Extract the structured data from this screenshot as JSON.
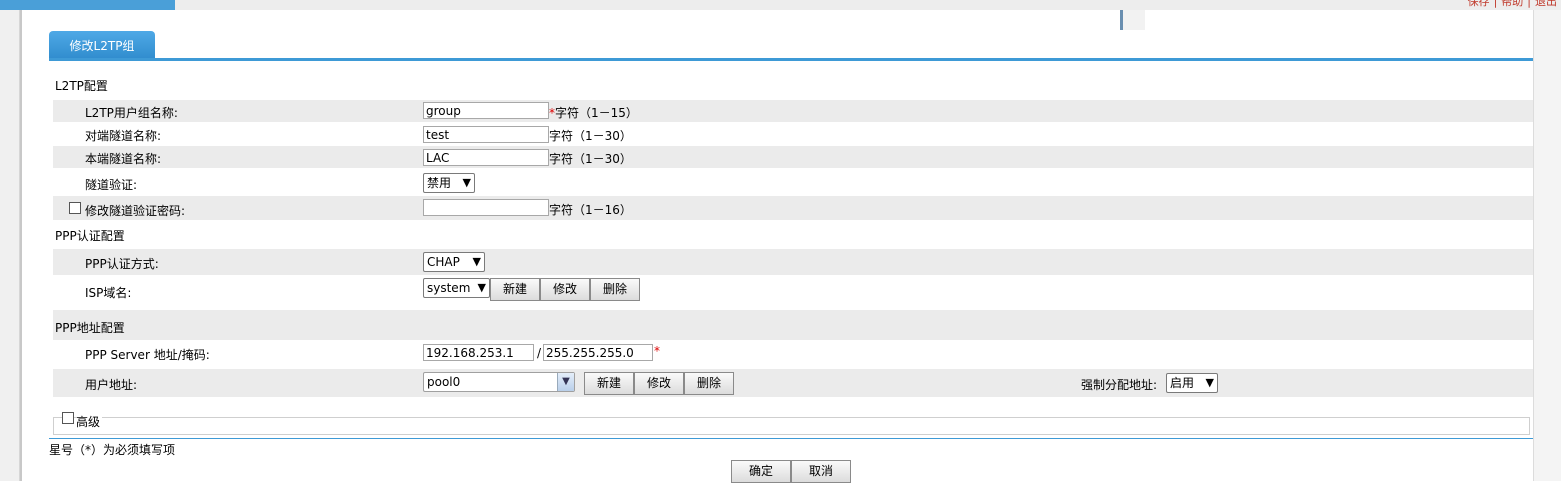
{
  "top": {
    "links": [
      "保存",
      "帮助",
      "退出"
    ]
  },
  "tab": {
    "label": "修改L2TP组"
  },
  "l2tp": {
    "section_title": "L2TP配置",
    "group_name": {
      "label": "L2TP用户组名称:",
      "value": "group",
      "required_mark": "*",
      "hint": "字符（1－15）"
    },
    "peer_tunnel": {
      "label": "对端隧道名称:",
      "value": "test",
      "hint": "字符（1－30）"
    },
    "local_tunnel": {
      "label": "本端隧道名称:",
      "value": "LAC",
      "hint": "字符（1－30）"
    },
    "tunnel_auth": {
      "label": "隧道验证:",
      "selected": "禁用"
    },
    "tunnel_password": {
      "label": "修改隧道验证密码:",
      "value": "",
      "hint": "字符（1－16）"
    }
  },
  "ppp_auth": {
    "section_title": "PPP认证配置",
    "method": {
      "label": "PPP认证方式:",
      "selected": "CHAP"
    },
    "isp": {
      "label": "ISP域名:",
      "selected": "system",
      "buttons": {
        "new": "新建",
        "modify": "修改",
        "delete": "删除"
      }
    }
  },
  "ppp_addr": {
    "section_title": "PPP地址配置",
    "server": {
      "label": "PPP Server 地址/掩码:",
      "ip": "192.168.253.1",
      "separator": "/",
      "mask": "255.255.255.0",
      "required_mark": "*"
    },
    "user_addr": {
      "label": "用户地址:",
      "selected": "pool0",
      "buttons": {
        "new": "新建",
        "modify": "修改",
        "delete": "删除"
      }
    },
    "force_assign": {
      "label": "强制分配地址:",
      "selected": "启用"
    }
  },
  "advanced": {
    "label": "高级"
  },
  "footer": {
    "note": "星号（*）为必须填写项",
    "ok": "确定",
    "cancel": "取消"
  }
}
